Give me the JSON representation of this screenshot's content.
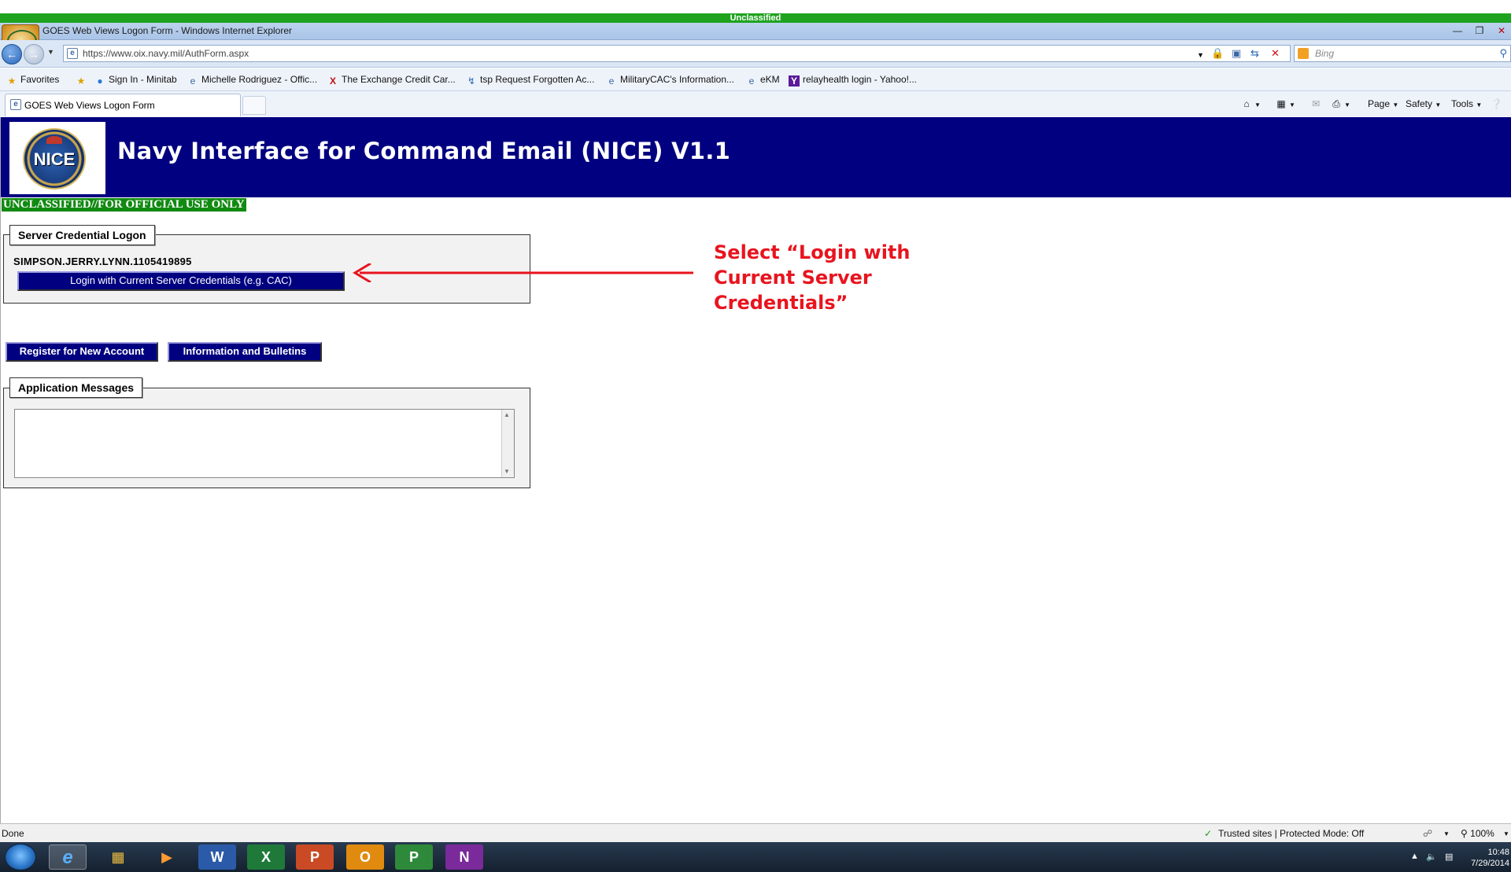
{
  "window": {
    "classification_banner": "Unclassified",
    "title": "GOES Web Views Logon Form - Windows Internet Explorer"
  },
  "address_bar": {
    "url": "https://www.oix.navy.mil/AuthForm.aspx",
    "search_placeholder": "Bing"
  },
  "favorites_bar": {
    "favorites_label": "Favorites",
    "items": [
      "Sign In - Minitab",
      "Michelle Rodriguez - Offic...",
      "The Exchange  Credit Car...",
      "tsp Request Forgotten Ac...",
      "MilitaryCAC's Information...",
      "eKM",
      "relayhealth login - Yahoo!..."
    ]
  },
  "tabs": {
    "active_label": "GOES Web Views Logon Form"
  },
  "command_bar": {
    "page": "Page",
    "safety": "Safety",
    "tools": "Tools"
  },
  "page": {
    "banner_title": "Navy Interface for Command Email (NICE) V1.1",
    "logo_text": "NICE",
    "classification_marking": "UNCLASSIFIED//FOR OFFICIAL USE ONLY",
    "credential_section": {
      "legend": "Server Credential Logon",
      "user_id": "SIMPSON.JERRY.LYNN.1105419895",
      "login_button": "Login with Current Server Credentials (e.g. CAC)"
    },
    "register_button": "Register for New Account",
    "info_button": "Information and Bulletins",
    "messages_section": {
      "legend": "Application Messages",
      "content": ""
    },
    "annotation": "Select “Login with Current Server Credentials”",
    "annotation_color": "#e8141e",
    "banner_color": "#000080"
  },
  "status_bar": {
    "status": "Done",
    "zone": "Trusted sites | Protected Mode: Off",
    "zoom": "100%"
  },
  "taskbar": {
    "apps": [
      "internet-explorer",
      "windows-explorer",
      "media-player",
      "word",
      "excel",
      "powerpoint",
      "outlook",
      "project",
      "onenote"
    ],
    "time": "10:48",
    "date": "7/29/2014"
  }
}
